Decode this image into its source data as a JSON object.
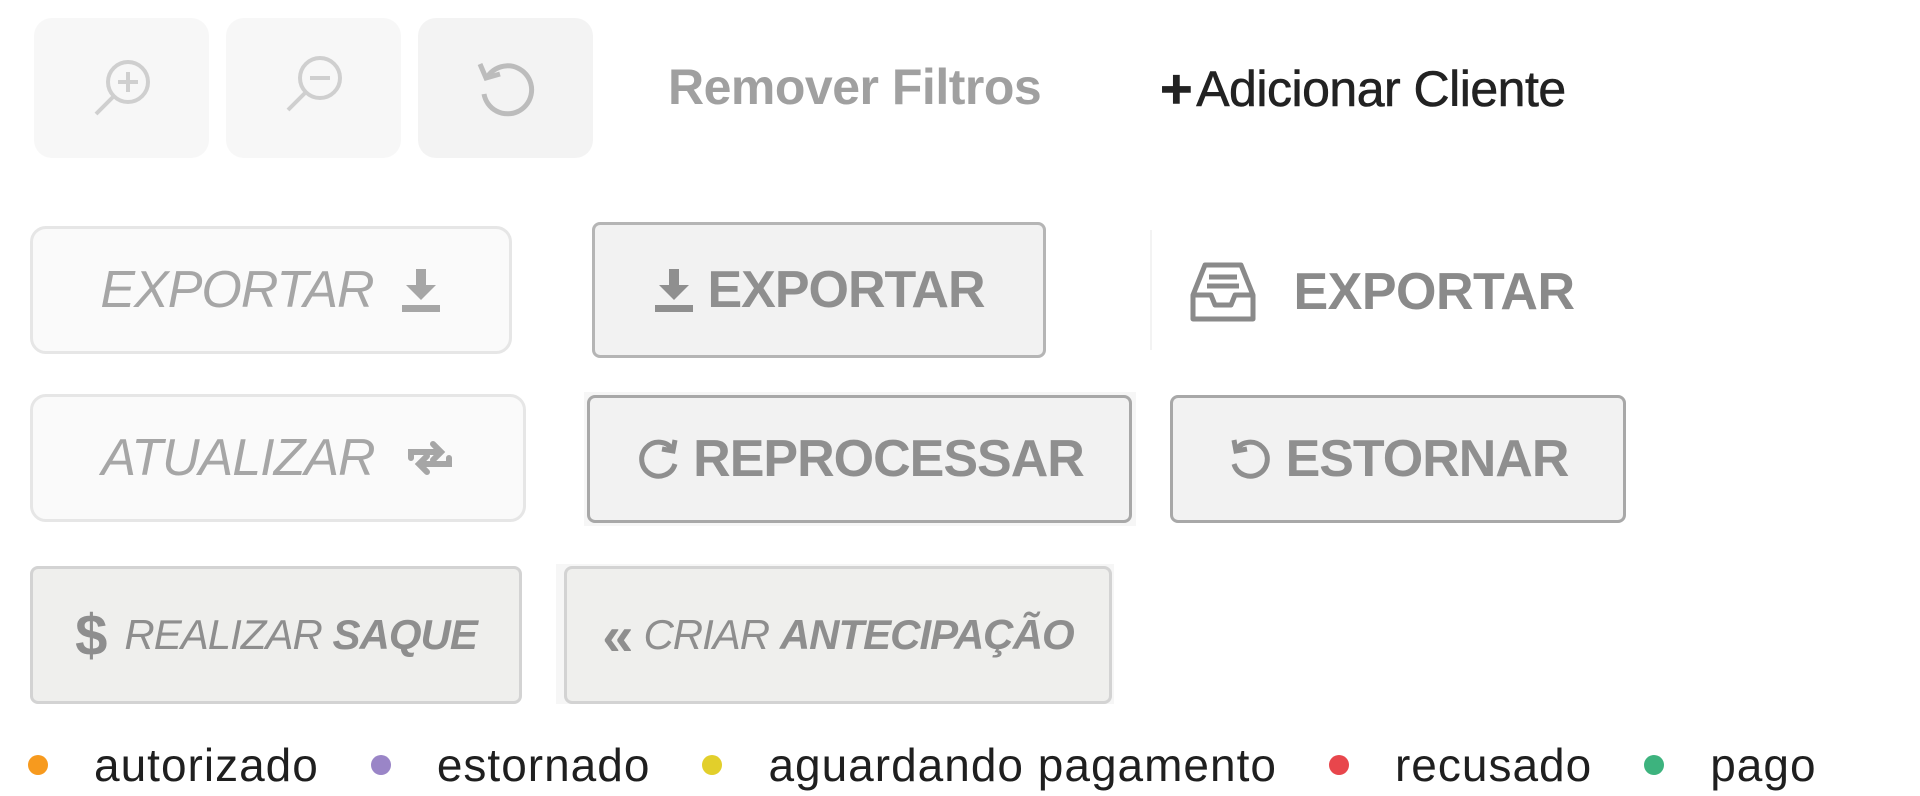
{
  "toolbar": {
    "zoom_in_icon": "zoom-in-icon",
    "zoom_out_icon": "zoom-out-icon",
    "reset_icon": "reset-icon",
    "remove_filters_label": "Remover Filtros",
    "add_client_plus": "+",
    "add_client_label": "Adicionar Cliente"
  },
  "export_buttons": {
    "light_label": "EXPORTAR",
    "gray_label": "EXPORTAR",
    "flat_label": "EXPORTAR"
  },
  "process_buttons": {
    "update_label": "ATUALIZAR",
    "reprocess_label": "REPROCESSAR",
    "refund_label": "ESTORNAR"
  },
  "money_buttons": {
    "withdraw_symbol": "$",
    "withdraw_prefix": "REALIZAR",
    "withdraw_bold": "SAQUE",
    "advance_symbol": "«",
    "advance_prefix": "CRIAR",
    "advance_bold": "ANTECIPAÇÃO"
  },
  "legend": {
    "items": [
      {
        "label": "autorizado",
        "color": "#f79a1e"
      },
      {
        "label": "estornado",
        "color": "#9a85c7"
      },
      {
        "label": "aguardando pagamento",
        "color": "#e2cf2b"
      },
      {
        "label": "recusado",
        "color": "#e8464c"
      },
      {
        "label": "pago",
        "color": "#3db37e"
      }
    ]
  }
}
